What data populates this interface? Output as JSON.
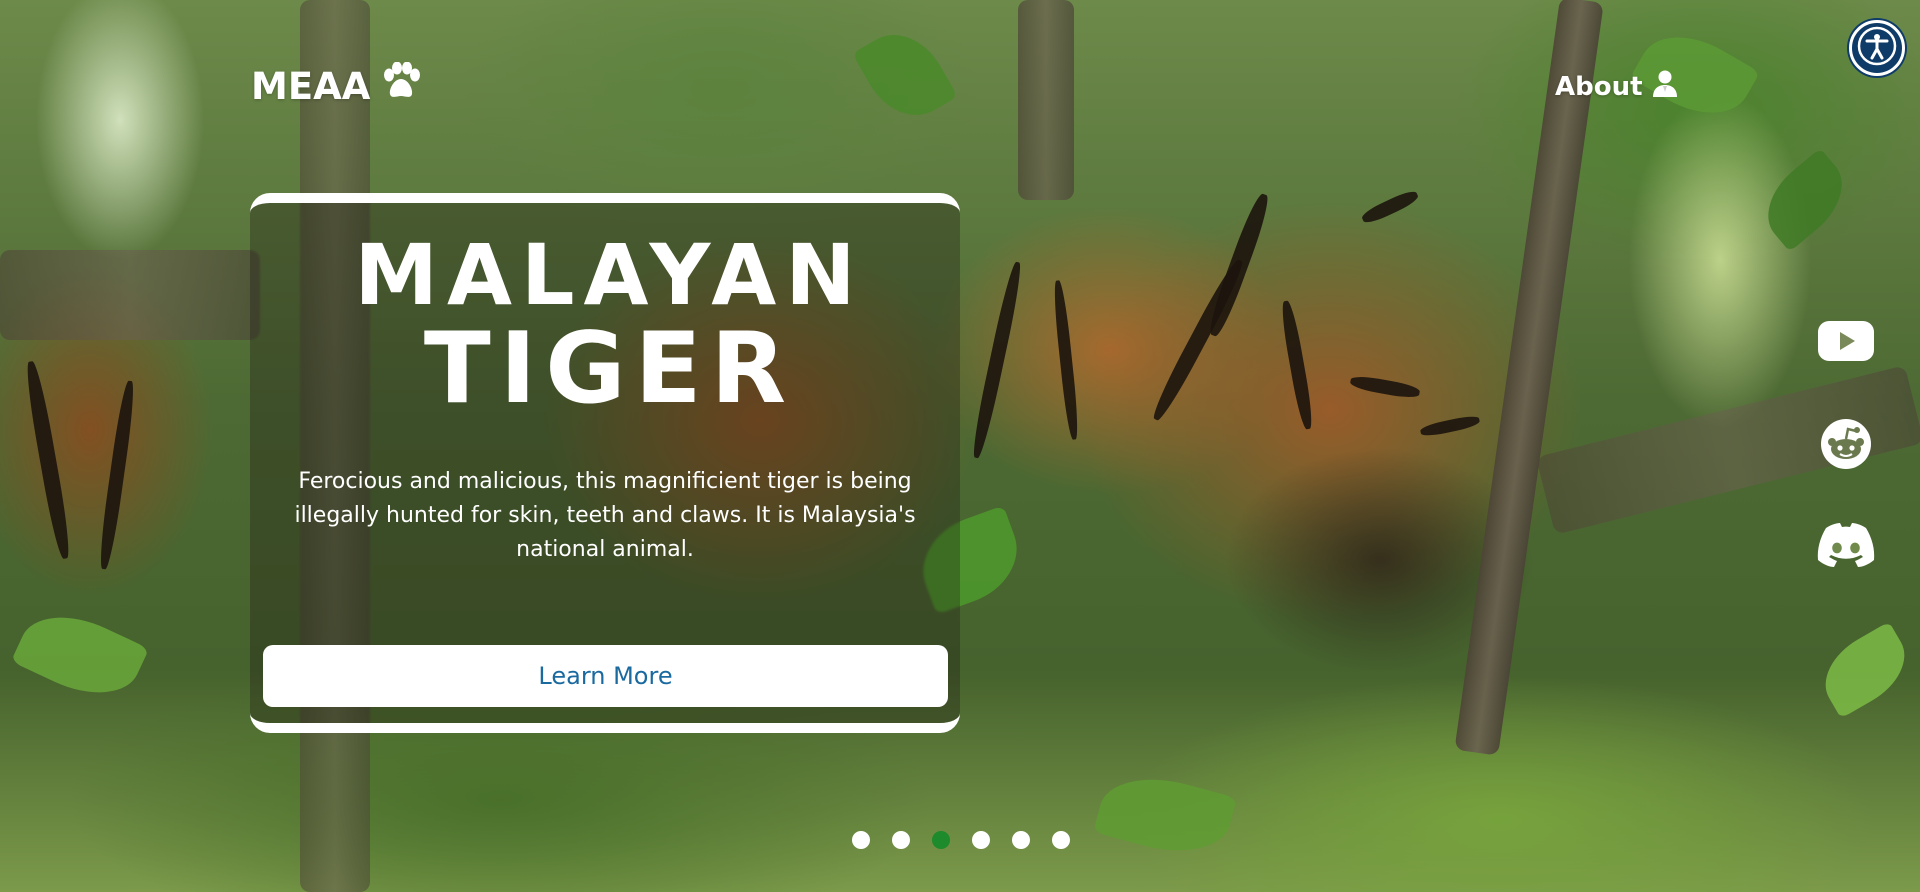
{
  "header": {
    "brand_label": "MEAA",
    "brand_icon": "paw-icon",
    "about_label": "About",
    "about_icon": "user-icon"
  },
  "accessibility": {
    "icon": "accessibility-icon"
  },
  "social": [
    {
      "name": "youtube",
      "icon": "youtube-icon"
    },
    {
      "name": "reddit",
      "icon": "reddit-icon"
    },
    {
      "name": "discord",
      "icon": "discord-icon"
    }
  ],
  "hero": {
    "title_line1": "MALAYAN",
    "title_line2": "TIGER",
    "description": "Ferocious and malicious, this magnificient tiger is being illegally hunted for skin, teeth and claws. It is Malaysia's national animal.",
    "button_label": "Learn More"
  },
  "carousel": {
    "slide_count": 6,
    "active_index": 2
  },
  "colors": {
    "button_text": "#1a6aa0",
    "active_dot": "#1d8a2c",
    "accessibility_bg": "#0f3b69"
  }
}
